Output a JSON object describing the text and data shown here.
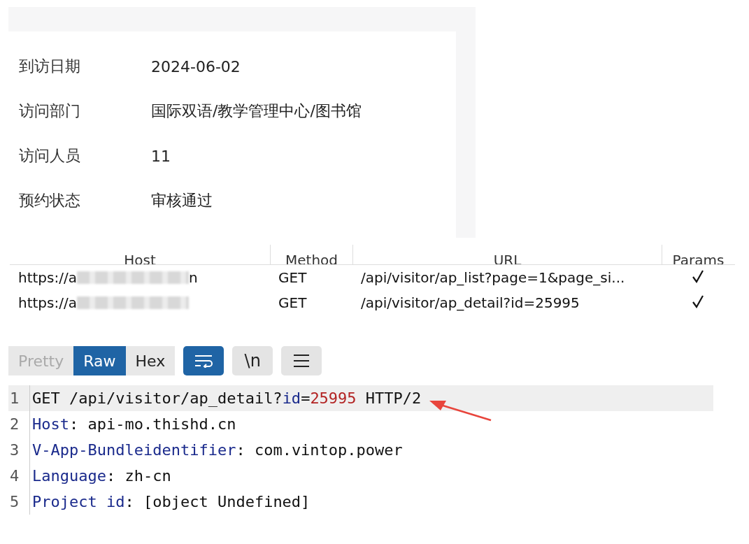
{
  "detail": {
    "fields": [
      {
        "label": "到访日期",
        "value": "2024-06-02"
      },
      {
        "label": "访问部门",
        "value": "国际双语/教学管理中心/图书馆"
      },
      {
        "label": "访问人员",
        "value": "11"
      },
      {
        "label": "预约状态",
        "value": "审核通过"
      }
    ]
  },
  "table": {
    "columns": [
      "Host",
      "Method",
      "URL",
      "Params"
    ],
    "rows": [
      {
        "host": "https://a",
        "host_tail": "n",
        "method": "GET",
        "url": "/api/visitor/ap_list?page=1&page_si...",
        "params": true
      },
      {
        "host": "https://a",
        "method": "GET",
        "url": "/api/visitor/ap_detail?id=25995",
        "params": true
      }
    ]
  },
  "editor": {
    "tabs": [
      {
        "label": "Pretty",
        "selected": false,
        "disabled": true
      },
      {
        "label": "Raw",
        "selected": true,
        "disabled": false
      },
      {
        "label": "Hex",
        "selected": false,
        "disabled": false
      }
    ],
    "tools": [
      {
        "kind": "wrap",
        "selected": true
      },
      {
        "kind": "text",
        "label": "\\n",
        "selected": false
      },
      {
        "kind": "menu",
        "selected": false
      }
    ],
    "lines": [
      {
        "number": "1",
        "highlighted": true,
        "segments": [
          {
            "kind": "plain",
            "text": "GET /api/visitor/ap_detail?"
          },
          {
            "kind": "key",
            "text": "id"
          },
          {
            "kind": "plain",
            "text": "="
          },
          {
            "kind": "value",
            "text": "25995"
          },
          {
            "kind": "plain",
            "text": " HTTP/2"
          }
        ]
      },
      {
        "number": "2",
        "highlighted": false,
        "segments": [
          {
            "kind": "key",
            "text": "Host"
          },
          {
            "kind": "plain",
            "text": ": api-mo.thishd.cn"
          }
        ]
      },
      {
        "number": "3",
        "highlighted": false,
        "segments": [
          {
            "kind": "key",
            "text": "V-App-Bundleidentifier"
          },
          {
            "kind": "plain",
            "text": ": com.vintop.power"
          }
        ]
      },
      {
        "number": "4",
        "highlighted": false,
        "segments": [
          {
            "kind": "key",
            "text": "Language"
          },
          {
            "kind": "plain",
            "text": ": zh-cn"
          }
        ]
      },
      {
        "number": "5",
        "highlighted": false,
        "segments": [
          {
            "kind": "key",
            "text": "Project id"
          },
          {
            "kind": "plain",
            "text": ": [object Undefined]"
          }
        ]
      }
    ]
  }
}
